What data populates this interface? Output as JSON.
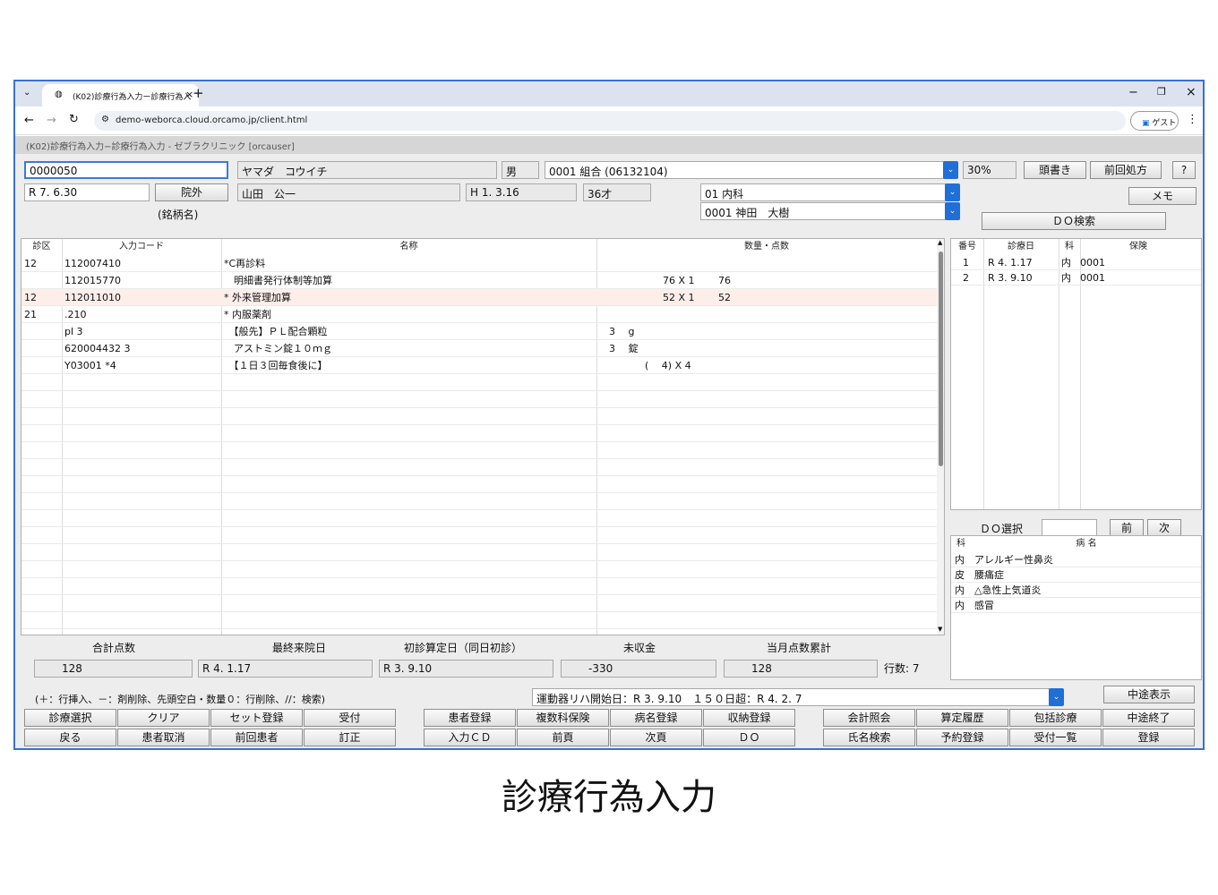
{
  "browser": {
    "tab_title": "(K02)診療行為入力ー診療行為入",
    "url": "demo-weborca.cloud.orcamo.jp/client.html",
    "profile_label": "ゲスト"
  },
  "window_title": "(K02)診療行為入力−診療行為入力 - ゼブラクリニック [orcauser]",
  "header": {
    "patient_id": "0000050",
    "kana_name": "ヤマダ　コウイチ",
    "sex": "男",
    "insurance": "0001 組合 (06132104)",
    "rate": "30%",
    "btn_toushogaki": "頭書き",
    "btn_zenkai": "前回処方",
    "btn_help": "?",
    "date": "R 7. 6.30",
    "btn_ingai": "院外",
    "meigara": "(銘柄名)",
    "kanji_name": "山田　公一",
    "birthdate": "H 1. 3.16",
    "age": "36才",
    "department": "01 内科",
    "doctor": "0001 神田　大樹",
    "btn_memo": "メモ",
    "btn_do_search": "ＤＯ検索"
  },
  "main_table": {
    "headers": [
      "診区",
      "入力コード",
      "名称",
      "数量・点数"
    ],
    "rows": [
      {
        "ku": "12",
        "code": "112007410",
        "name": "*C再診料",
        "qty": "",
        "pts": ""
      },
      {
        "ku": "",
        "code": "112015770",
        "name": "　明細書発行体制等加算",
        "qty": "76 X 1",
        "pts": "76"
      },
      {
        "ku": "12",
        "code": "112011010",
        "name": "* 外来管理加算",
        "qty": "52 X 1",
        "pts": "52"
      },
      {
        "ku": "21",
        "code": ".210",
        "name": "* 内服薬剤",
        "qty": "",
        "pts": ""
      },
      {
        "ku": "",
        "code": "pl 3",
        "name": "　【般先】ＰＬ配合顆粒",
        "qty": "3　 g",
        "pts": ""
      },
      {
        "ku": "",
        "code": "620004432 3",
        "name": "　アストミン錠１０ｍｇ",
        "qty": "3　 錠",
        "pts": ""
      },
      {
        "ku": "",
        "code": "Y03001 *4",
        "name": "　【１日３回毎食後に】",
        "qty": "(　 4) X 4",
        "pts": ""
      }
    ]
  },
  "history_table": {
    "headers": [
      "番号",
      "診療日",
      "科",
      "保険"
    ],
    "rows": [
      {
        "no": "1",
        "date": "R 4. 1.17",
        "ka": "内",
        "ins": "0001"
      },
      {
        "no": "2",
        "date": "R 3. 9.10",
        "ka": "内",
        "ins": "0001"
      }
    ]
  },
  "do_select": {
    "label": "ＤＯ選択",
    "value": "",
    "btn_prev": "前",
    "btn_next": "次"
  },
  "disease_table": {
    "headers": [
      "科",
      "病 名"
    ],
    "rows": [
      {
        "ka": "内",
        "name": "アレルギー性鼻炎"
      },
      {
        "ka": "皮",
        "name": "腰痛症"
      },
      {
        "ka": "内",
        "name": "△急性上気道炎"
      },
      {
        "ka": "内",
        "name": "感冒"
      }
    ]
  },
  "summary": {
    "labels": [
      "合計点数",
      "最終来院日",
      "初診算定日（同日初診）",
      "未収金",
      "当月点数累計"
    ],
    "values": [
      "128",
      "R 4. 1.17",
      "R 3. 9.10",
      "-330",
      "128"
    ],
    "rows_label": "行数:",
    "rows_count": "7"
  },
  "hint": "(＋：行挿入、－：剤削除、先頭空白・数量０：行削除、//：検索)",
  "rehab_combo": "運動器リハ開始日：R 3. 9.10　１５０日超：R 4. 2. 7",
  "btn_chuto_hyoji": "中途表示",
  "buttons_row1": [
    "診療選択",
    "クリア",
    "セット登録",
    "受付",
    "患者登録",
    "複数科保険",
    "病名登録",
    "収納登録",
    "会計照会",
    "算定履歴",
    "包括診療",
    "中途終了"
  ],
  "buttons_row2": [
    "戻る",
    "患者取消",
    "前回患者",
    "訂正",
    "入力ＣＤ",
    "前頁",
    "次頁",
    "ＤＯ",
    "氏名検索",
    "予約登録",
    "受付一覧",
    "登録"
  ],
  "caption": "診療行為入力",
  "colors": {
    "accent": "#1f6fd6",
    "highlight_row": "#fdeeea",
    "frame": "#3b6fd4"
  }
}
